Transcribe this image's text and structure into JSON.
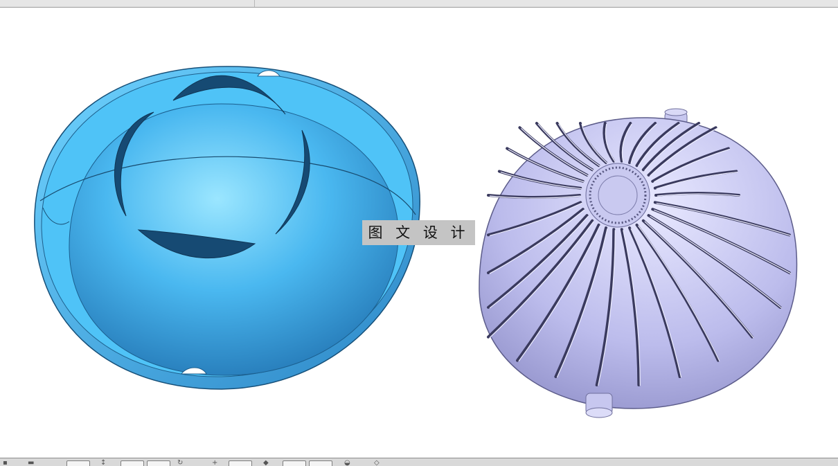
{
  "watermark": {
    "text": "图 文 设 计"
  },
  "models": [
    {
      "name": "inner-shell",
      "color": "#3aa3e6"
    },
    {
      "name": "slotted-dome",
      "color": "#b7b7e8"
    }
  ],
  "toolbar": {
    "icons": [
      "view-icon",
      "select-icon",
      "rotate-icon",
      "zoom-icon",
      "pan-icon",
      "shade-icon",
      "section-icon",
      "render-icon"
    ]
  }
}
